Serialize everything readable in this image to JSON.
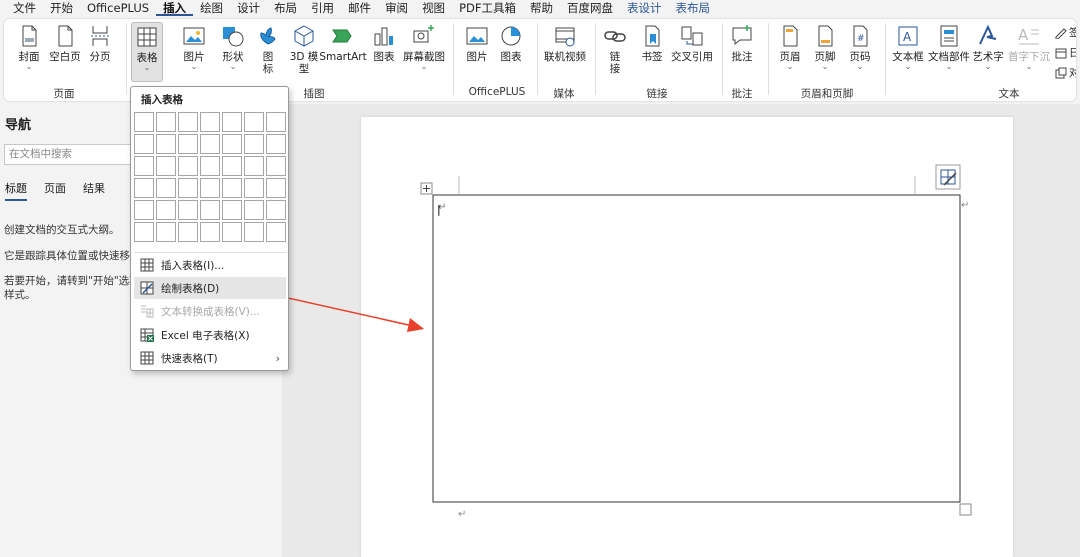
{
  "menu": {
    "file": "文件",
    "home": "开始",
    "officeplus": "OfficePLUS",
    "insert": "插入",
    "draw": "绘图",
    "design": "设计",
    "layout": "布局",
    "references": "引用",
    "mailings": "邮件",
    "review": "审阅",
    "view": "视图",
    "pdf": "PDF工具箱",
    "help": "帮助",
    "baidu": "百度网盘",
    "table_design": "表设计",
    "table_layout": "表布局"
  },
  "ribbon": {
    "cover": "封面",
    "blank_page": "空白页",
    "page_break": "分页",
    "table": "表格",
    "picture": "图片",
    "shapes": "形状",
    "icons": "图",
    "icons2": "标",
    "model3d": "3D 模",
    "model3d2": "型",
    "smartart": "SmartArt",
    "chart": "图表",
    "screenshot": "屏幕截图",
    "op_picture": "图片",
    "op_chart": "图表",
    "online_video": "联机视频",
    "link": "链",
    "link2": "接",
    "bookmark": "书签",
    "cross_ref": "交叉引用",
    "comment": "批注",
    "header": "页眉",
    "footer": "页脚",
    "page_number": "页码",
    "text_box": "文本框",
    "quick_parts": "文档部件",
    "wordart": "艺术字",
    "drop_cap": "首字下沉",
    "signature": "签",
    "date": "日",
    "object": "对",
    "groups": {
      "pages": "页面",
      "illustrations": "插图",
      "officeplus": "OfficePLUS",
      "media": "媒体",
      "links": "链接",
      "comments": "批注",
      "header_footer": "页眉和页脚",
      "text": "文本"
    }
  },
  "nav": {
    "title": "导航",
    "search_placeholder": "在文档中搜索",
    "tabs": [
      "标题",
      "页面",
      "结果"
    ],
    "line1": "创建文档的交互式大纲。",
    "line2": "它是跟踪具体位置或快速移动",
    "line3": "若要开始，请转到\"开始\"选项",
    "line4": "样式。"
  },
  "popup": {
    "title": "插入表格",
    "insert_table": "插入表格(I)...",
    "draw_table": "绘制表格(D)",
    "convert_text": "文本转换成表格(V)...",
    "excel": "Excel 电子表格(X)",
    "quick_tables": "快速表格(T)"
  },
  "document": {
    "paragraph_mark": "↵",
    "text_cursor": "|"
  },
  "colors": {
    "accent": "#2b579a",
    "arrow": "#e8402a"
  }
}
